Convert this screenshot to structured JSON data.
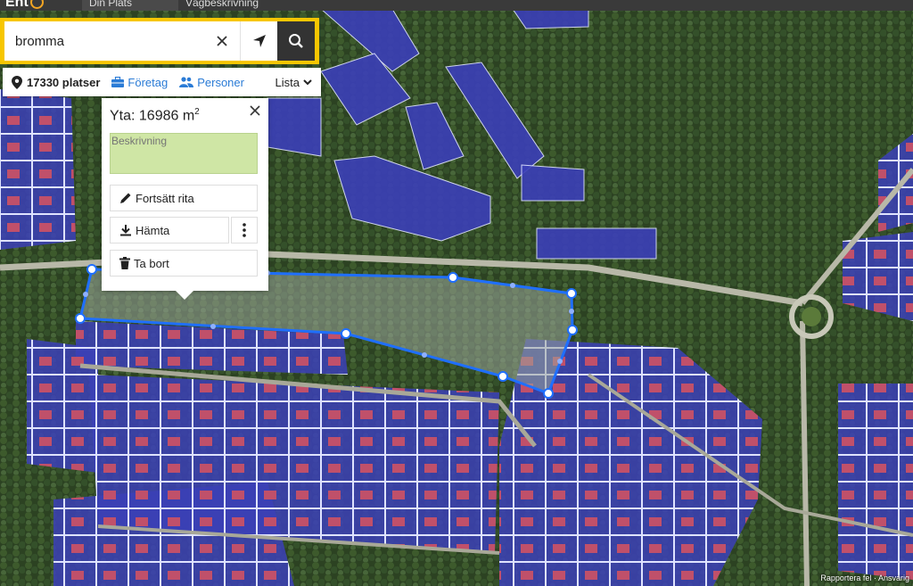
{
  "topbar": {
    "logo": "Ent",
    "tab1": "Din Plats",
    "tab2": "Vägbeskrivning"
  },
  "search": {
    "value": "bromma",
    "clear_icon": "close-icon",
    "locate_icon": "location-arrow-icon",
    "search_icon": "search-icon"
  },
  "results": {
    "count": "17330 platser",
    "companies": "Företag",
    "persons": "Personer",
    "list": "Lista"
  },
  "popup": {
    "area_label": "Yta: 16986 m",
    "area_unit_sup": "2",
    "description_placeholder": "Beskrivning",
    "continue_draw": "Fortsätt rita",
    "download": "Hämta",
    "delete": "Ta bort"
  },
  "footer": {
    "report": "Rapportera fel",
    "separator": "·",
    "terms": "Ansvarig"
  },
  "colors": {
    "accent": "#f7c600",
    "link": "#2a7bd6",
    "polygon_stroke": "#1f6fff",
    "parcel_fill": "#3a3ad6",
    "roof": "#d64a8a"
  }
}
